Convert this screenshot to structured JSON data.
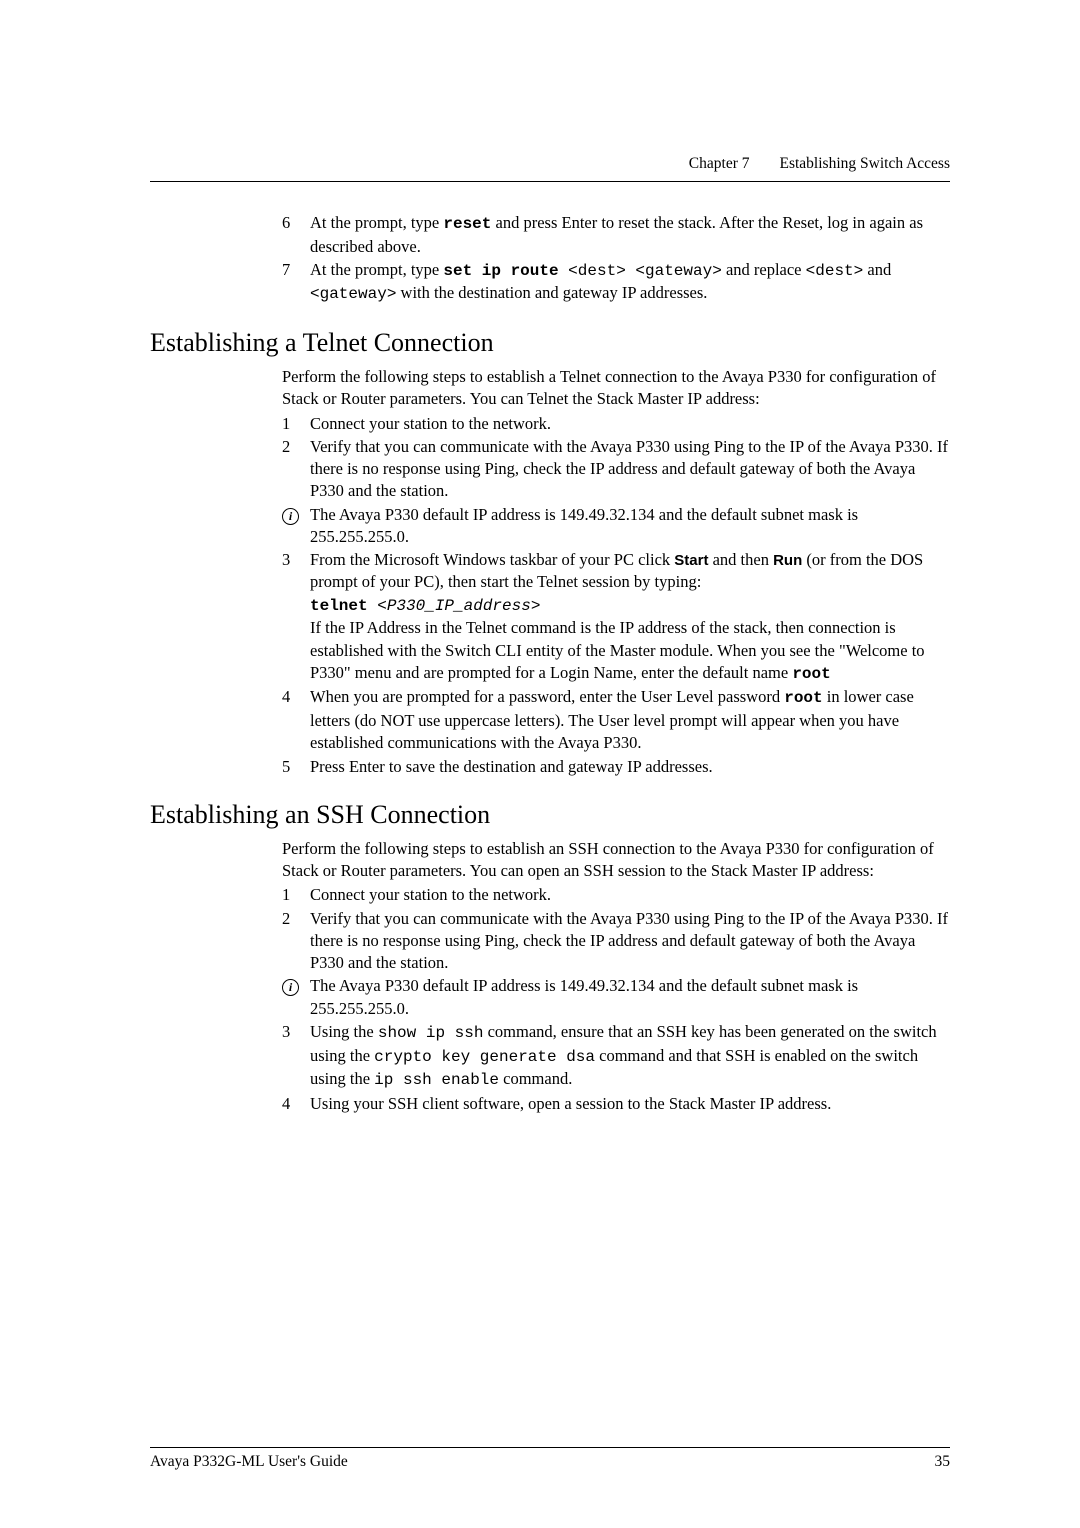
{
  "header": {
    "chapter": "Chapter 7",
    "title": "Establishing Switch Access"
  },
  "top_steps": {
    "step6": {
      "num": "6",
      "t1": "At the prompt, type ",
      "cmd": "reset",
      "t2": " and press Enter to reset the stack. After the Reset, log in again as described above."
    },
    "step7": {
      "num": "7",
      "t1": "At the prompt, type ",
      "cmd": "set ip route",
      "arg1": " <dest> <gateway>",
      "t2": " and replace ",
      "arg2": "<dest>",
      "t3": " and ",
      "arg3": "<gateway>",
      "t4": "  with the destination and gateway IP addresses."
    }
  },
  "telnet": {
    "heading": "Establishing a Telnet Connection",
    "intro": "Perform the following steps to establish a Telnet connection to the Avaya P330 for configuration of Stack or Router parameters. You can Telnet the Stack Master IP address:",
    "s1": {
      "num": "1",
      "text": "Connect your station to the network."
    },
    "s2": {
      "num": "2",
      "text": "Verify that you can communicate with the Avaya P330 using Ping to the IP of the Avaya P330. If there is no response using Ping, check the IP address and default gateway of both the Avaya P330 and the station."
    },
    "info1": "The Avaya P330 default IP address is 149.49.32.134 and the default subnet mask is 255.255.255.0.",
    "s3": {
      "num": "3",
      "t1": "From the Microsoft Windows taskbar of your PC click ",
      "start": "Start",
      "t2": " and then ",
      "run": "Run",
      "t3": " (or from the DOS prompt of your PC), then start the Telnet session by typing:",
      "cmd": "telnet",
      "arg": " <P330_IP_address>",
      "t4": "If the IP Address in the Telnet command is the IP address of the stack, then connection is established with the Switch CLI entity of the Master module. When you see the \"Welcome to P330\" menu and are prompted for a Login Name, enter the default name ",
      "root": " root"
    },
    "s4": {
      "num": "4",
      "t1": "When you are prompted for a password, enter the User Level password ",
      "root": " root",
      "t2": " in lower case letters (do NOT use uppercase letters). The User level prompt will appear when you have established communications with the Avaya P330."
    },
    "s5": {
      "num": "5",
      "text": "Press Enter to save the destination and gateway IP addresses."
    }
  },
  "ssh": {
    "heading": "Establishing an SSH Connection",
    "intro": "Perform the following steps to establish an SSH connection to the Avaya P330 for configuration of Stack or Router parameters. You can open an SSH session to the Stack Master IP address:",
    "s1": {
      "num": "1",
      "text": "Connect your station to the network."
    },
    "s2": {
      "num": "2",
      "text": "Verify that you can communicate with the Avaya P330 using Ping to the IP of the Avaya P330. If there is no response using Ping, check the IP address and default gateway of both the Avaya P330 and the station."
    },
    "info1": "The Avaya P330 default IP address is 149.49.32.134 and the default subnet mask is 255.255.255.0.",
    "s3": {
      "num": "3",
      "t1": "Using the ",
      "cmd1": "show ip ssh",
      "t2": " command, ensure that an SSH key has been generated on the switch using the ",
      "cmd2": "crypto key generate dsa",
      "t3": " command and that SSH is enabled on the switch using the ",
      "cmd3": "ip ssh enable",
      "t4": " command."
    },
    "s4": {
      "num": "4",
      "text": "Using your SSH client software, open a session to the Stack Master IP address."
    }
  },
  "footer": {
    "guide": "Avaya P332G-ML User's Guide",
    "page": "35"
  }
}
